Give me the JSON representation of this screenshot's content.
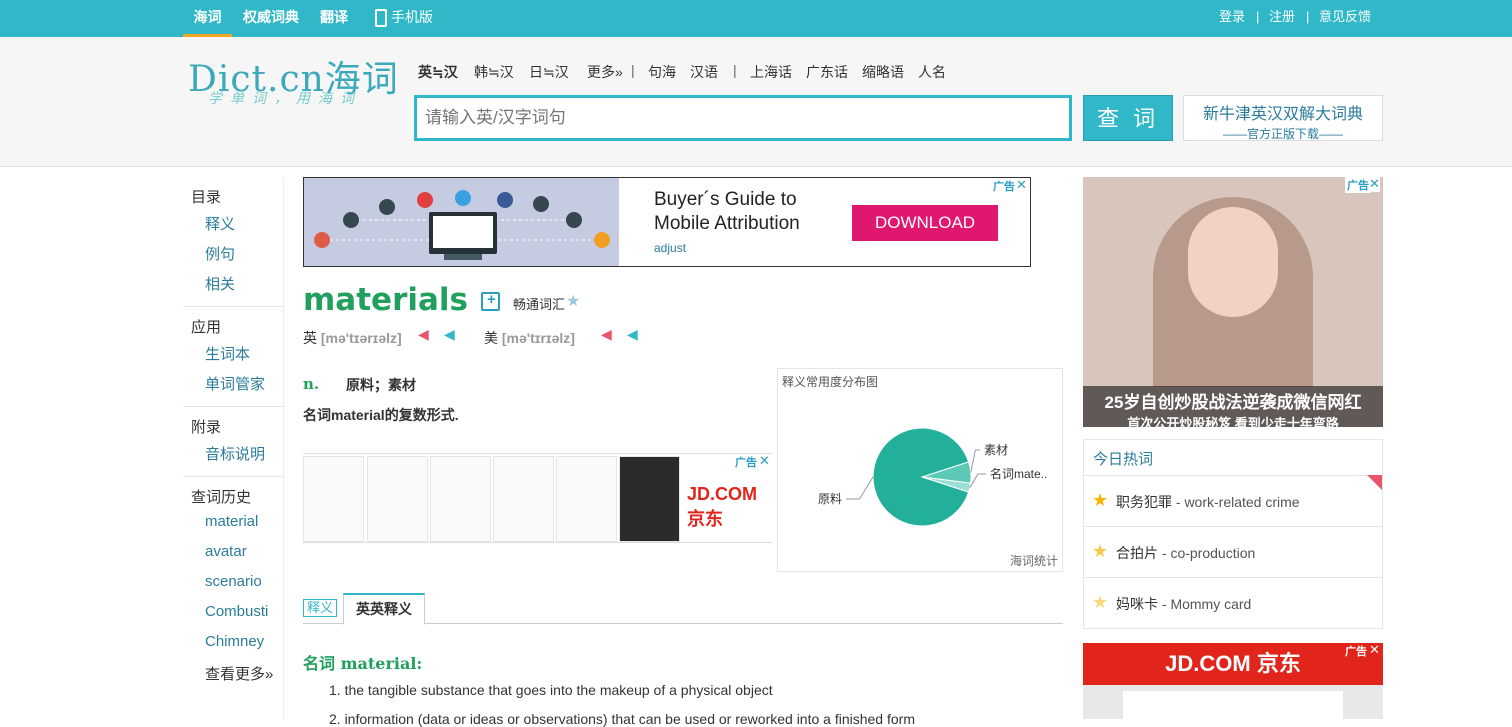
{
  "topnav": {
    "items": [
      "海词",
      "权威词典",
      "翻译",
      "手机版"
    ],
    "right": [
      "登录",
      "注册",
      "意见反馈"
    ],
    "separator": "|"
  },
  "logo": {
    "text": "Dict.cn海词",
    "slogan": "学单词，用海词"
  },
  "lang_tabs": [
    "英≒汉",
    "韩≒汉",
    "日≒汉",
    "更多»",
    "|",
    "句海",
    "汉语",
    "|",
    "上海话",
    "广东话",
    "缩略语",
    "人名"
  ],
  "search": {
    "placeholder": "请输入英/汉字词句",
    "button": "查 词"
  },
  "promo": {
    "title": "新牛津英汉双解大词典",
    "sub": "——官方正版下载——"
  },
  "sidebar": {
    "sections": [
      {
        "title": "目录",
        "items": [
          "释义",
          "例句",
          "相关"
        ]
      },
      {
        "title": "应用",
        "items": [
          "生词本",
          "单词管家"
        ]
      },
      {
        "title": "附录",
        "items": [
          "音标说明"
        ]
      },
      {
        "title": "查词历史",
        "items": [
          "material",
          "avatar",
          "scenario",
          "Combusti",
          "Chimney",
          "查看更多»"
        ]
      }
    ]
  },
  "ad_banner": {
    "title_line1": "Buyer´s Guide to",
    "title_line2": "Mobile Attribution",
    "button": "DOWNLOAD",
    "brand": "adjust",
    "ad_label": "广告",
    "close": "✕"
  },
  "entry": {
    "word": "materials",
    "vocab_tag": "畅通词汇",
    "uk_label": "英",
    "uk_phonetic": "[mə'tɪərɪəlz]",
    "us_label": "美",
    "us_phonetic": "[mə'tɪrɪəlz]",
    "pos": "n.",
    "definition": "原料；素材",
    "plural_note": "名词material的复数形式."
  },
  "ad_products": {
    "ad_label": "广告",
    "close": "✕",
    "brand": "JD.COM 京东"
  },
  "chart_data": {
    "type": "pie",
    "title": "释义常用度分布图",
    "footer": "海词统计",
    "labels": [
      "原料",
      "素材",
      "名词mate.."
    ],
    "values": [
      90,
      7,
      3
    ],
    "colors": [
      "#22b09a",
      "#5cc9b5",
      "#9adfd2"
    ]
  },
  "def_tabs": {
    "active": "英英释义",
    "other": "释义"
  },
  "english_def": {
    "heading": "名词 material:",
    "senses": [
      "1. the tangible substance that goes into the makeup of a physical object",
      "2. information (data or ideas or observations) that can be used or reworked into a finished form"
    ]
  },
  "side_ad": {
    "line1": "25岁自创炒股战法逆袭成微信网红",
    "line2": "首次公开炒股秘笈 看到少走十年弯路",
    "ad_label": "广告",
    "close": "✕"
  },
  "hot_words": {
    "title": "今日热词",
    "items": [
      {
        "zh": "职务犯罪",
        "en": "- work-related crime"
      },
      {
        "zh": "合拍片",
        "en": "- co-production"
      },
      {
        "zh": "妈咪卡",
        "en": "- Mommy card"
      }
    ]
  },
  "bottom_ad": {
    "brand": "JD.COM 京东",
    "ad_label": "广告",
    "close": "✕"
  }
}
